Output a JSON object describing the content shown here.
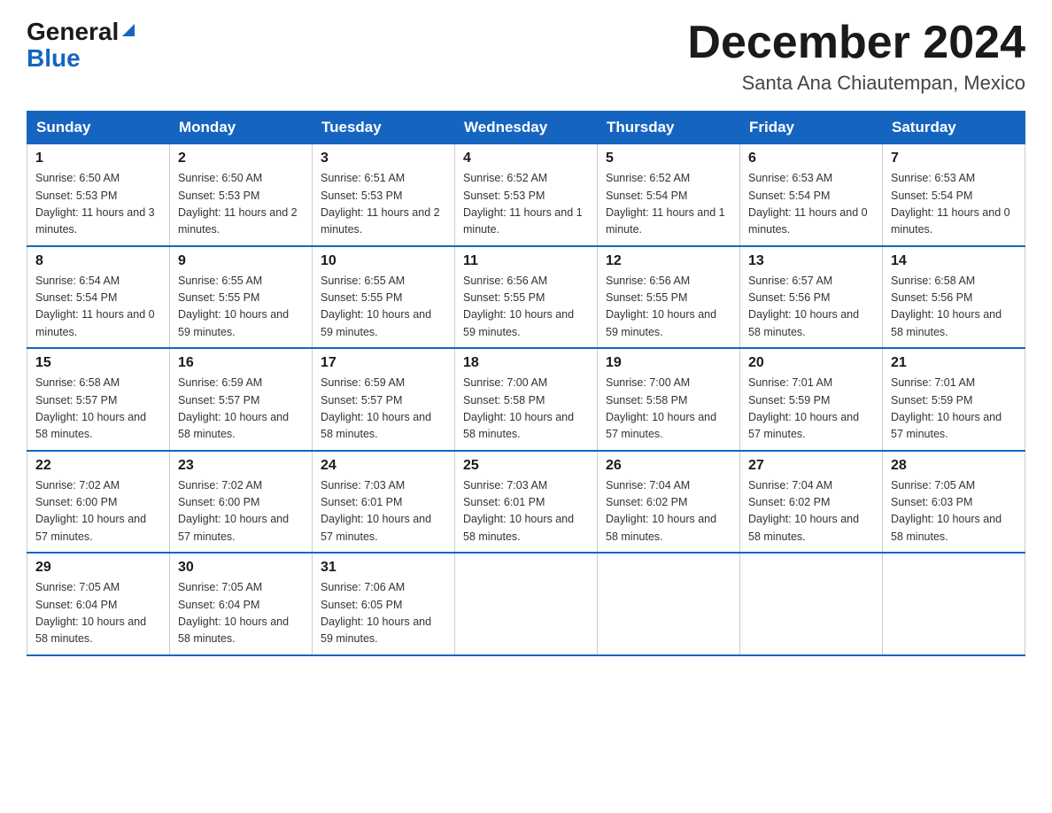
{
  "header": {
    "logo_general": "General",
    "logo_blue": "Blue",
    "month_title": "December 2024",
    "subtitle": "Santa Ana Chiautempan, Mexico"
  },
  "days_of_week": [
    "Sunday",
    "Monday",
    "Tuesday",
    "Wednesday",
    "Thursday",
    "Friday",
    "Saturday"
  ],
  "weeks": [
    [
      {
        "num": "1",
        "sunrise": "6:50 AM",
        "sunset": "5:53 PM",
        "daylight": "11 hours and 3 minutes."
      },
      {
        "num": "2",
        "sunrise": "6:50 AM",
        "sunset": "5:53 PM",
        "daylight": "11 hours and 2 minutes."
      },
      {
        "num": "3",
        "sunrise": "6:51 AM",
        "sunset": "5:53 PM",
        "daylight": "11 hours and 2 minutes."
      },
      {
        "num": "4",
        "sunrise": "6:52 AM",
        "sunset": "5:53 PM",
        "daylight": "11 hours and 1 minute."
      },
      {
        "num": "5",
        "sunrise": "6:52 AM",
        "sunset": "5:54 PM",
        "daylight": "11 hours and 1 minute."
      },
      {
        "num": "6",
        "sunrise": "6:53 AM",
        "sunset": "5:54 PM",
        "daylight": "11 hours and 0 minutes."
      },
      {
        "num": "7",
        "sunrise": "6:53 AM",
        "sunset": "5:54 PM",
        "daylight": "11 hours and 0 minutes."
      }
    ],
    [
      {
        "num": "8",
        "sunrise": "6:54 AM",
        "sunset": "5:54 PM",
        "daylight": "11 hours and 0 minutes."
      },
      {
        "num": "9",
        "sunrise": "6:55 AM",
        "sunset": "5:55 PM",
        "daylight": "10 hours and 59 minutes."
      },
      {
        "num": "10",
        "sunrise": "6:55 AM",
        "sunset": "5:55 PM",
        "daylight": "10 hours and 59 minutes."
      },
      {
        "num": "11",
        "sunrise": "6:56 AM",
        "sunset": "5:55 PM",
        "daylight": "10 hours and 59 minutes."
      },
      {
        "num": "12",
        "sunrise": "6:56 AM",
        "sunset": "5:55 PM",
        "daylight": "10 hours and 59 minutes."
      },
      {
        "num": "13",
        "sunrise": "6:57 AM",
        "sunset": "5:56 PM",
        "daylight": "10 hours and 58 minutes."
      },
      {
        "num": "14",
        "sunrise": "6:58 AM",
        "sunset": "5:56 PM",
        "daylight": "10 hours and 58 minutes."
      }
    ],
    [
      {
        "num": "15",
        "sunrise": "6:58 AM",
        "sunset": "5:57 PM",
        "daylight": "10 hours and 58 minutes."
      },
      {
        "num": "16",
        "sunrise": "6:59 AM",
        "sunset": "5:57 PM",
        "daylight": "10 hours and 58 minutes."
      },
      {
        "num": "17",
        "sunrise": "6:59 AM",
        "sunset": "5:57 PM",
        "daylight": "10 hours and 58 minutes."
      },
      {
        "num": "18",
        "sunrise": "7:00 AM",
        "sunset": "5:58 PM",
        "daylight": "10 hours and 58 minutes."
      },
      {
        "num": "19",
        "sunrise": "7:00 AM",
        "sunset": "5:58 PM",
        "daylight": "10 hours and 57 minutes."
      },
      {
        "num": "20",
        "sunrise": "7:01 AM",
        "sunset": "5:59 PM",
        "daylight": "10 hours and 57 minutes."
      },
      {
        "num": "21",
        "sunrise": "7:01 AM",
        "sunset": "5:59 PM",
        "daylight": "10 hours and 57 minutes."
      }
    ],
    [
      {
        "num": "22",
        "sunrise": "7:02 AM",
        "sunset": "6:00 PM",
        "daylight": "10 hours and 57 minutes."
      },
      {
        "num": "23",
        "sunrise": "7:02 AM",
        "sunset": "6:00 PM",
        "daylight": "10 hours and 57 minutes."
      },
      {
        "num": "24",
        "sunrise": "7:03 AM",
        "sunset": "6:01 PM",
        "daylight": "10 hours and 57 minutes."
      },
      {
        "num": "25",
        "sunrise": "7:03 AM",
        "sunset": "6:01 PM",
        "daylight": "10 hours and 58 minutes."
      },
      {
        "num": "26",
        "sunrise": "7:04 AM",
        "sunset": "6:02 PM",
        "daylight": "10 hours and 58 minutes."
      },
      {
        "num": "27",
        "sunrise": "7:04 AM",
        "sunset": "6:02 PM",
        "daylight": "10 hours and 58 minutes."
      },
      {
        "num": "28",
        "sunrise": "7:05 AM",
        "sunset": "6:03 PM",
        "daylight": "10 hours and 58 minutes."
      }
    ],
    [
      {
        "num": "29",
        "sunrise": "7:05 AM",
        "sunset": "6:04 PM",
        "daylight": "10 hours and 58 minutes."
      },
      {
        "num": "30",
        "sunrise": "7:05 AM",
        "sunset": "6:04 PM",
        "daylight": "10 hours and 58 minutes."
      },
      {
        "num": "31",
        "sunrise": "7:06 AM",
        "sunset": "6:05 PM",
        "daylight": "10 hours and 59 minutes."
      },
      null,
      null,
      null,
      null
    ]
  ]
}
